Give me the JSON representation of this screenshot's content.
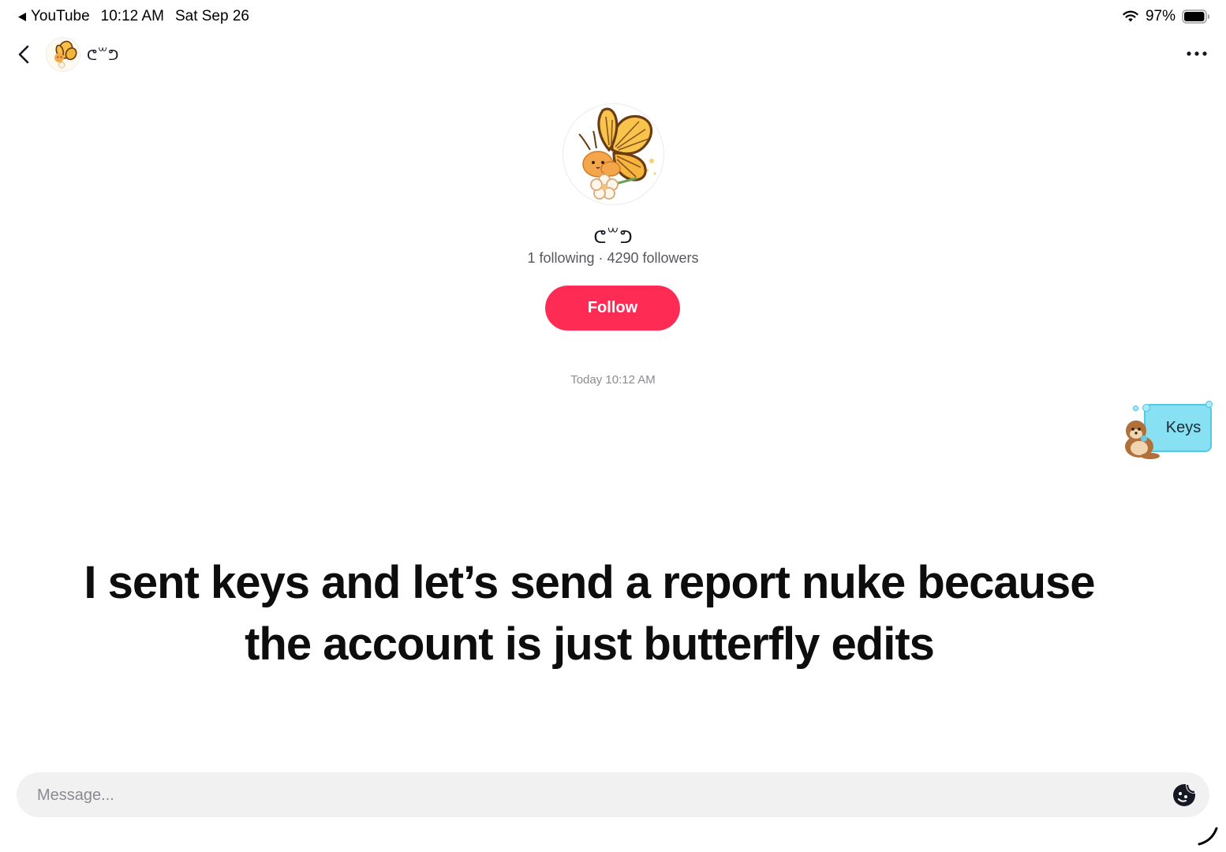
{
  "status_bar": {
    "back_app": "YouTube",
    "time": "10:12 AM",
    "date": "Sat Sep 26",
    "battery": "97%",
    "icons": [
      "back-triangle-icon",
      "wifi-icon",
      "battery-icon"
    ]
  },
  "nav": {
    "username": "ᕦ꒳ᕤ",
    "icons": [
      "chevron-left-icon",
      "avatar",
      "more-icon"
    ]
  },
  "profile": {
    "name": "ᕦ꒳ᕤ",
    "stats": "1 following · 4290 followers",
    "follow_label": "Follow"
  },
  "conversation": {
    "timestamp": "Today 10:12 AM",
    "sticker_text": "Keys"
  },
  "overlay": {
    "line1": "I sent keys and let’s send a report nuke because",
    "line2": "the account is just butterfly edits"
  },
  "composer": {
    "placeholder": "Message..."
  },
  "colors": {
    "follow": "#fe2c55",
    "sticker_bubble": "#87e1f3",
    "composer_bg": "#f1f1f2"
  }
}
